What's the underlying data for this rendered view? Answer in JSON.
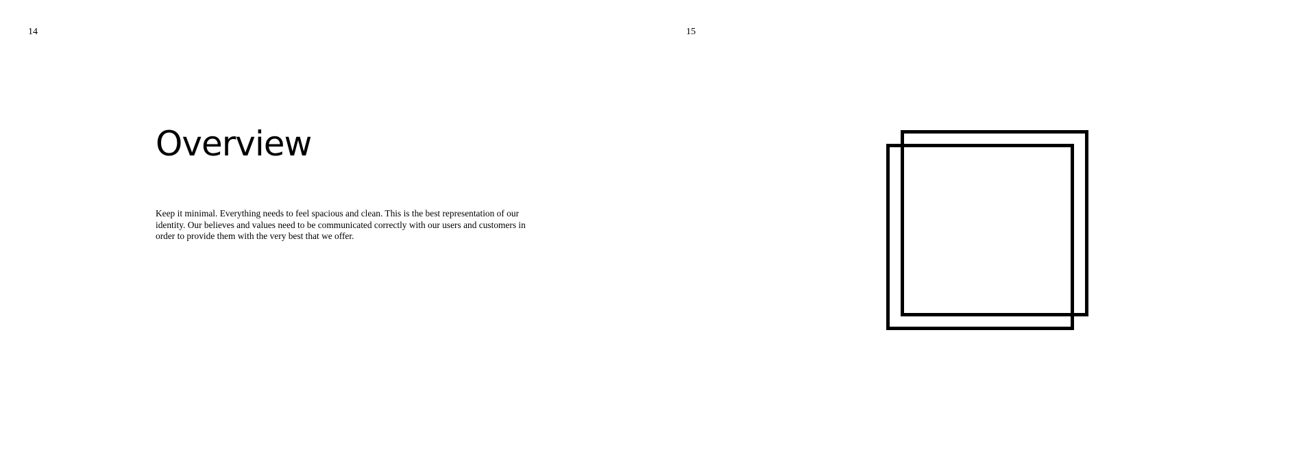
{
  "left_page": {
    "page_number": "14",
    "title": "Overview",
    "body": "Keep it minimal. Everything needs to feel spacious and clean. This is the best representation of our identity. Our believes and values need to be communicated correctly with our users and customers in order to provide them with the very best that we offer."
  },
  "right_page": {
    "page_number": "15",
    "illustration": "overlapping-squares-outline"
  },
  "colors": {
    "background": "#ffffff",
    "ink": "#000000"
  }
}
